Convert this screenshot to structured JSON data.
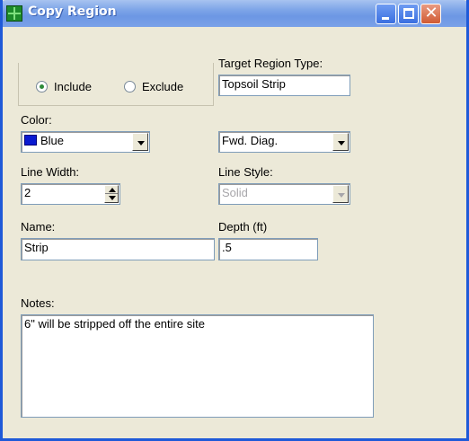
{
  "window": {
    "title": "Copy Region",
    "icon": "region-grid-icon"
  },
  "titlebar_buttons": {
    "minimize": "minimize-icon",
    "maximize": "maximize-icon",
    "close": "close-icon",
    "close_glyph": "✕"
  },
  "mode": {
    "include_label": "Include",
    "exclude_label": "Exclude",
    "selected": "Include"
  },
  "target_region_type": {
    "label": "Target Region Type:",
    "value": "Topsoil Strip"
  },
  "color": {
    "label": "Color:",
    "value": "Blue",
    "swatch": "#0a1ad1"
  },
  "fill_pattern": {
    "value": "Fwd. Diag."
  },
  "line_width": {
    "label": "Line Width:",
    "value": "2"
  },
  "line_style": {
    "label": "Line Style:",
    "value": "Solid",
    "disabled": true
  },
  "name": {
    "label": "Name:",
    "value": "Strip"
  },
  "depth": {
    "label": "Depth (ft)",
    "value": ".5"
  },
  "notes": {
    "label": "Notes:",
    "value": "6\" will be stripped off the entire site"
  }
}
